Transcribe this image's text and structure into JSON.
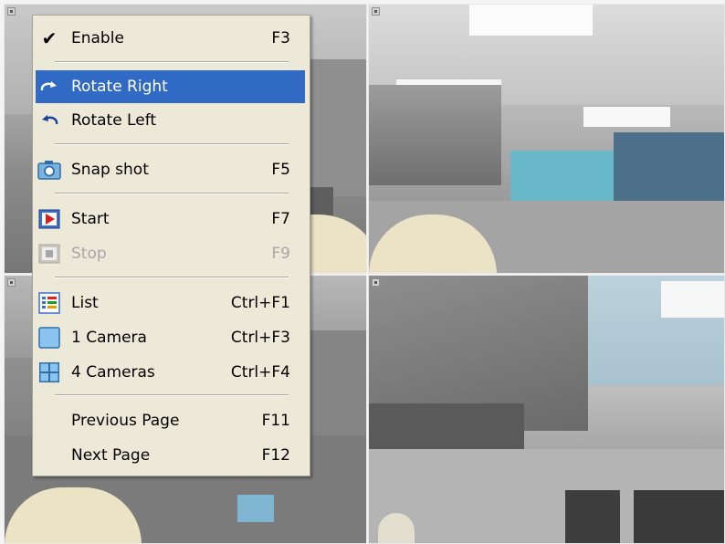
{
  "menu": {
    "items": [
      {
        "id": "enable",
        "label": "Enable",
        "shortcut": "F3",
        "checked": true,
        "icon": "check-icon"
      },
      {
        "id": "rotate-right",
        "label": "Rotate Right",
        "shortcut": "",
        "selected": true,
        "icon": "rotate-right-icon"
      },
      {
        "id": "rotate-left",
        "label": "Rotate Left",
        "shortcut": "",
        "icon": "rotate-left-icon"
      },
      {
        "id": "snapshot",
        "label": "Snap shot",
        "shortcut": "F5",
        "icon": "camera-icon"
      },
      {
        "id": "start",
        "label": "Start",
        "shortcut": "F7",
        "icon": "play-icon"
      },
      {
        "id": "stop",
        "label": "Stop",
        "shortcut": "F9",
        "disabled": true,
        "icon": "stop-icon"
      },
      {
        "id": "list",
        "label": "List",
        "shortcut": "Ctrl+F1",
        "icon": "list-view-icon"
      },
      {
        "id": "one-camera",
        "label": "1 Camera",
        "shortcut": "Ctrl+F3",
        "icon": "single-view-icon"
      },
      {
        "id": "four-cameras",
        "label": "4 Cameras",
        "shortcut": "Ctrl+F4",
        "icon": "quad-view-icon"
      },
      {
        "id": "previous-page",
        "label": "Previous Page",
        "shortcut": "F11",
        "icon": ""
      },
      {
        "id": "next-page",
        "label": "Next Page",
        "shortcut": "F12",
        "icon": ""
      }
    ]
  },
  "colors": {
    "menu_bg": "#ece9d8",
    "highlight": "#316ac5",
    "disabled_text": "#a7a6aa"
  }
}
